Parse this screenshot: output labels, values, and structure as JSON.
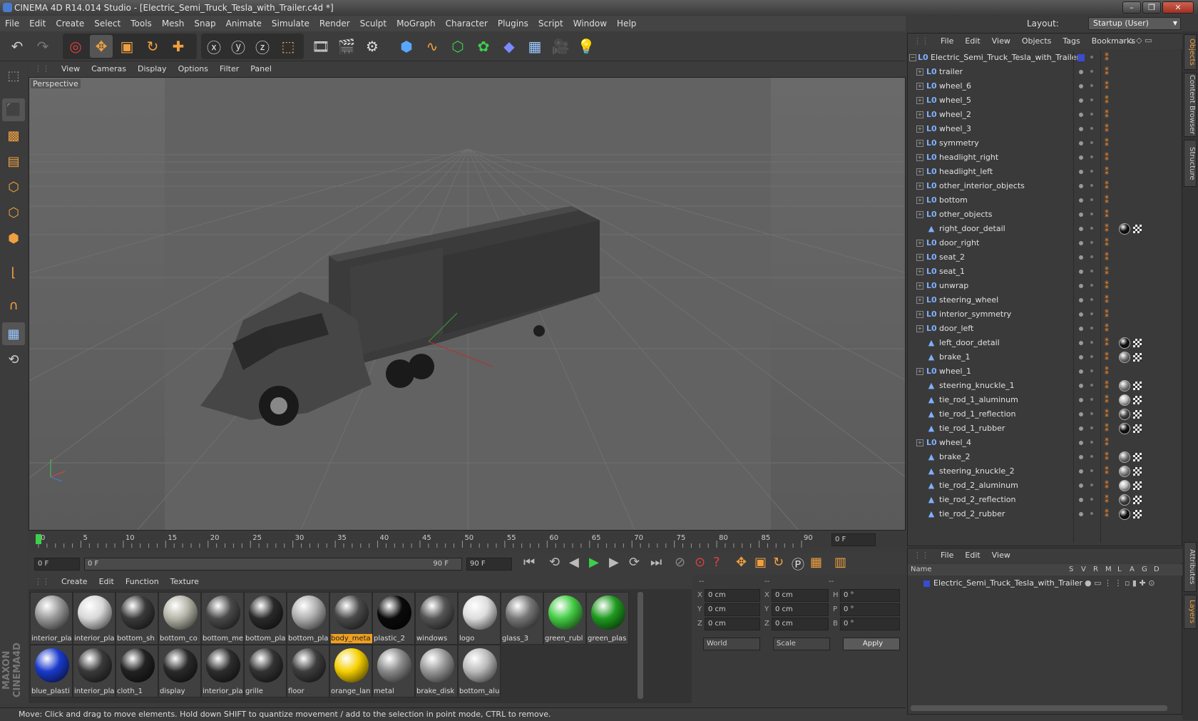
{
  "title": "CINEMA 4D R14.014 Studio - [Electric_Semi_Truck_Tesla_with_Trailer.c4d *]",
  "window_buttons": [
    "–",
    "❐",
    "✕"
  ],
  "menu": [
    "File",
    "Edit",
    "Create",
    "Select",
    "Tools",
    "Mesh",
    "Snap",
    "Animate",
    "Simulate",
    "Render",
    "Sculpt",
    "MoGraph",
    "Character",
    "Plugins",
    "Script",
    "Window",
    "Help"
  ],
  "layout": {
    "label": "Layout:",
    "value": "Startup (User)"
  },
  "viewport": {
    "menu": [
      "View",
      "Cameras",
      "Display",
      "Options",
      "Filter",
      "Panel"
    ],
    "label": "Perspective"
  },
  "timeline": {
    "ticks": [
      "0",
      "5",
      "10",
      "15",
      "20",
      "25",
      "30",
      "35",
      "40",
      "45",
      "50",
      "55",
      "60",
      "65",
      "70",
      "75",
      "80",
      "85",
      "90"
    ],
    "end_field": "0 F",
    "start_field": "0 F",
    "range_start": "0 F",
    "range_end": "90 F",
    "max_field": "90 F"
  },
  "materials": {
    "menu": [
      "Create",
      "Edit",
      "Function",
      "Texture"
    ],
    "items": [
      {
        "name": "interior_pla",
        "color": "#9a9a9a"
      },
      {
        "name": "interior_pla",
        "color": "#d8d8d8"
      },
      {
        "name": "bottom_sh",
        "color": "#3a3a3a"
      },
      {
        "name": "bottom_co",
        "color": "#b5b5a8"
      },
      {
        "name": "bottom_me",
        "color": "#4a4a4a"
      },
      {
        "name": "bottom_pla",
        "color": "#2a2a2a"
      },
      {
        "name": "bottom_pla",
        "color": "#b0b0b0"
      },
      {
        "name": "body_meta",
        "color": "#4a4a4a",
        "selected": true
      },
      {
        "name": "plastic_2",
        "color": "#0a0a0a"
      },
      {
        "name": "windows",
        "color": "#555555"
      },
      {
        "name": "logo",
        "color": "#dddddd"
      },
      {
        "name": "glass_3",
        "color": "#777777"
      },
      {
        "name": "green_rubl",
        "color": "#44cc44"
      },
      {
        "name": "green_plas",
        "color": "#1f9a1f"
      },
      {
        "name": "blue_plasti",
        "color": "#1a3acc"
      },
      {
        "name": "interior_pla",
        "color": "#3a3a3a"
      },
      {
        "name": "cloth_1",
        "color": "#222222"
      },
      {
        "name": "display",
        "color": "#2a2a2a"
      },
      {
        "name": "interior_pla",
        "color": "#2d2d2d"
      },
      {
        "name": "grille",
        "color": "#333333"
      },
      {
        "name": "floor",
        "color": "#3d3d3d"
      },
      {
        "name": "orange_lan",
        "color": "#f5d000"
      },
      {
        "name": "metal",
        "color": "#8a8a8a"
      },
      {
        "name": "brake_disk",
        "color": "#999999"
      },
      {
        "name": "bottom_alu",
        "color": "#bbbbbb"
      }
    ]
  },
  "coords": {
    "header": [
      "--",
      "--",
      "--"
    ],
    "rows": [
      {
        "a": "X",
        "av": "0 cm",
        "b": "X",
        "bv": "0 cm",
        "c": "H",
        "cv": "0 °"
      },
      {
        "a": "Y",
        "av": "0 cm",
        "b": "Y",
        "bv": "0 cm",
        "c": "P",
        "cv": "0 °"
      },
      {
        "a": "Z",
        "av": "0 cm",
        "b": "Z",
        "bv": "0 cm",
        "c": "B",
        "cv": "0 °"
      }
    ],
    "world": "World",
    "scale": "Scale",
    "apply": "Apply"
  },
  "status": "Move: Click and drag to move elements. Hold down SHIFT to quantize movement / add to the selection in point mode, CTRL to remove.",
  "objects": {
    "menu": [
      "File",
      "Edit",
      "View",
      "Objects",
      "Tags",
      "Bookmarks"
    ],
    "rows": [
      {
        "name": "Electric_Semi_Truck_Tesla_with_Trailer",
        "kind": "null",
        "root": true
      },
      {
        "name": "trailer",
        "kind": "null"
      },
      {
        "name": "wheel_6",
        "kind": "null"
      },
      {
        "name": "wheel_5",
        "kind": "null"
      },
      {
        "name": "wheel_2",
        "kind": "null"
      },
      {
        "name": "wheel_3",
        "kind": "null"
      },
      {
        "name": "symmetry",
        "kind": "null"
      },
      {
        "name": "headlight_right",
        "kind": "null"
      },
      {
        "name": "headlight_left",
        "kind": "null"
      },
      {
        "name": "other_interior_objects",
        "kind": "null"
      },
      {
        "name": "bottom",
        "kind": "null"
      },
      {
        "name": "other_objects",
        "kind": "null"
      },
      {
        "name": "right_door_detail",
        "kind": "mesh",
        "mat": "#111"
      },
      {
        "name": "door_right",
        "kind": "null"
      },
      {
        "name": "seat_2",
        "kind": "null"
      },
      {
        "name": "seat_1",
        "kind": "null"
      },
      {
        "name": "unwrap",
        "kind": "null"
      },
      {
        "name": "steering_wheel",
        "kind": "null"
      },
      {
        "name": "interior_symmetry",
        "kind": "null"
      },
      {
        "name": "door_left",
        "kind": "null"
      },
      {
        "name": "left_door_detail",
        "kind": "mesh",
        "mat": "#111"
      },
      {
        "name": "brake_1",
        "kind": "mesh",
        "mat": "#777"
      },
      {
        "name": "wheel_1",
        "kind": "null"
      },
      {
        "name": "steering_knuckle_1",
        "kind": "mesh",
        "mat": "#888"
      },
      {
        "name": "tie_rod_1_aluminum",
        "kind": "mesh",
        "mat": "#bbb"
      },
      {
        "name": "tie_rod_1_reflection",
        "kind": "mesh",
        "mat": "#444"
      },
      {
        "name": "tie_rod_1_rubber",
        "kind": "mesh",
        "mat": "#111"
      },
      {
        "name": "wheel_4",
        "kind": "null"
      },
      {
        "name": "brake_2",
        "kind": "mesh",
        "mat": "#777"
      },
      {
        "name": "steering_knuckle_2",
        "kind": "mesh",
        "mat": "#888"
      },
      {
        "name": "tie_rod_2_aluminum",
        "kind": "mesh",
        "mat": "#bbb"
      },
      {
        "name": "tie_rod_2_reflection",
        "kind": "mesh",
        "mat": "#444"
      },
      {
        "name": "tie_rod_2_rubber",
        "kind": "mesh",
        "mat": "#111"
      }
    ]
  },
  "attributes": {
    "menu": [
      "File",
      "Edit",
      "View"
    ],
    "columns": [
      "Name",
      "S",
      "V",
      "R",
      "M",
      "L",
      "A",
      "G",
      "D"
    ],
    "row": "Electric_Semi_Truck_Tesla_with_Trailer"
  },
  "side_tabs": [
    "Objects",
    "Content Browser",
    "Structure",
    "Attributes",
    "Layers"
  ]
}
